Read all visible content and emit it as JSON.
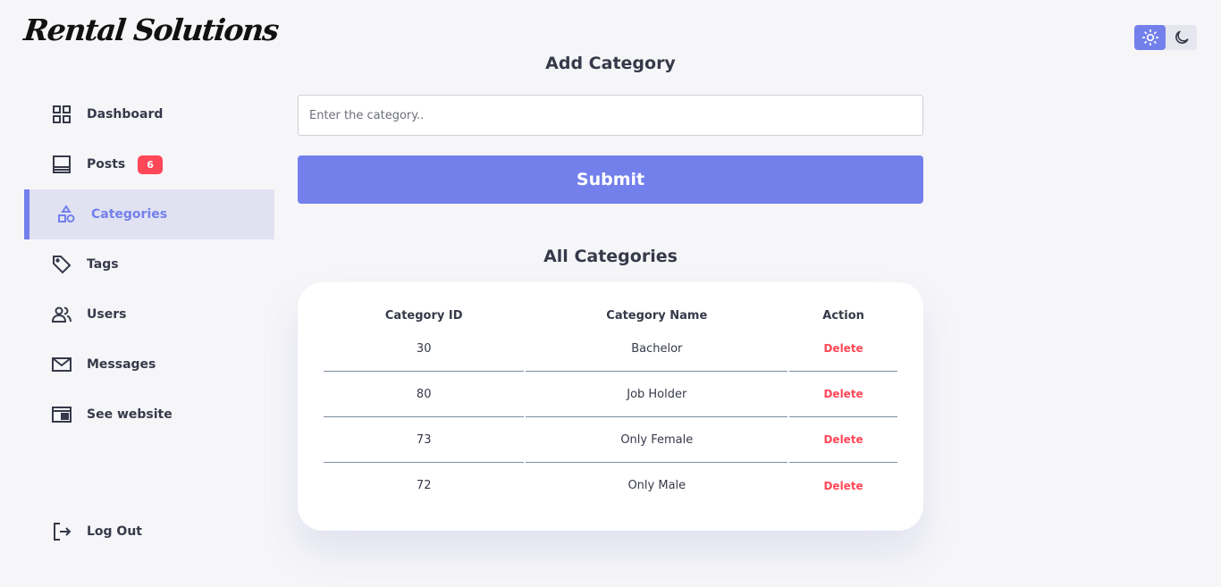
{
  "app": {
    "logo_text": "Rental Solutions"
  },
  "sidebar": {
    "items": [
      {
        "label": "Dashboard",
        "icon": "grid-icon"
      },
      {
        "label": "Posts",
        "icon": "posts-icon",
        "badge": "6"
      },
      {
        "label": "Categories",
        "icon": "category-shapes-icon",
        "active": true
      },
      {
        "label": "Tags",
        "icon": "tag-icon"
      },
      {
        "label": "Users",
        "icon": "users-icon"
      },
      {
        "label": "Messages",
        "icon": "mail-icon"
      },
      {
        "label": "See website",
        "icon": "website-icon"
      }
    ],
    "logout_label": "Log Out"
  },
  "theme": {
    "active": "light",
    "light_icon": "sun-icon",
    "dark_icon": "moon-icon"
  },
  "form": {
    "title": "Add Category",
    "input_placeholder": "Enter the category..",
    "input_value": "",
    "submit_label": "Submit"
  },
  "table": {
    "title": "All Categories",
    "headers": [
      "Category ID",
      "Category Name",
      "Action"
    ],
    "rows": [
      {
        "id": "30",
        "name": "Bachelor",
        "action": "Delete"
      },
      {
        "id": "80",
        "name": "Job Holder",
        "action": "Delete"
      },
      {
        "id": "73",
        "name": "Only Female",
        "action": "Delete"
      },
      {
        "id": "72",
        "name": "Only Male",
        "action": "Delete"
      }
    ]
  },
  "colors": {
    "accent": "#7380ec",
    "danger": "#ff4757",
    "background": "#f6f6f9",
    "text": "#363949"
  }
}
